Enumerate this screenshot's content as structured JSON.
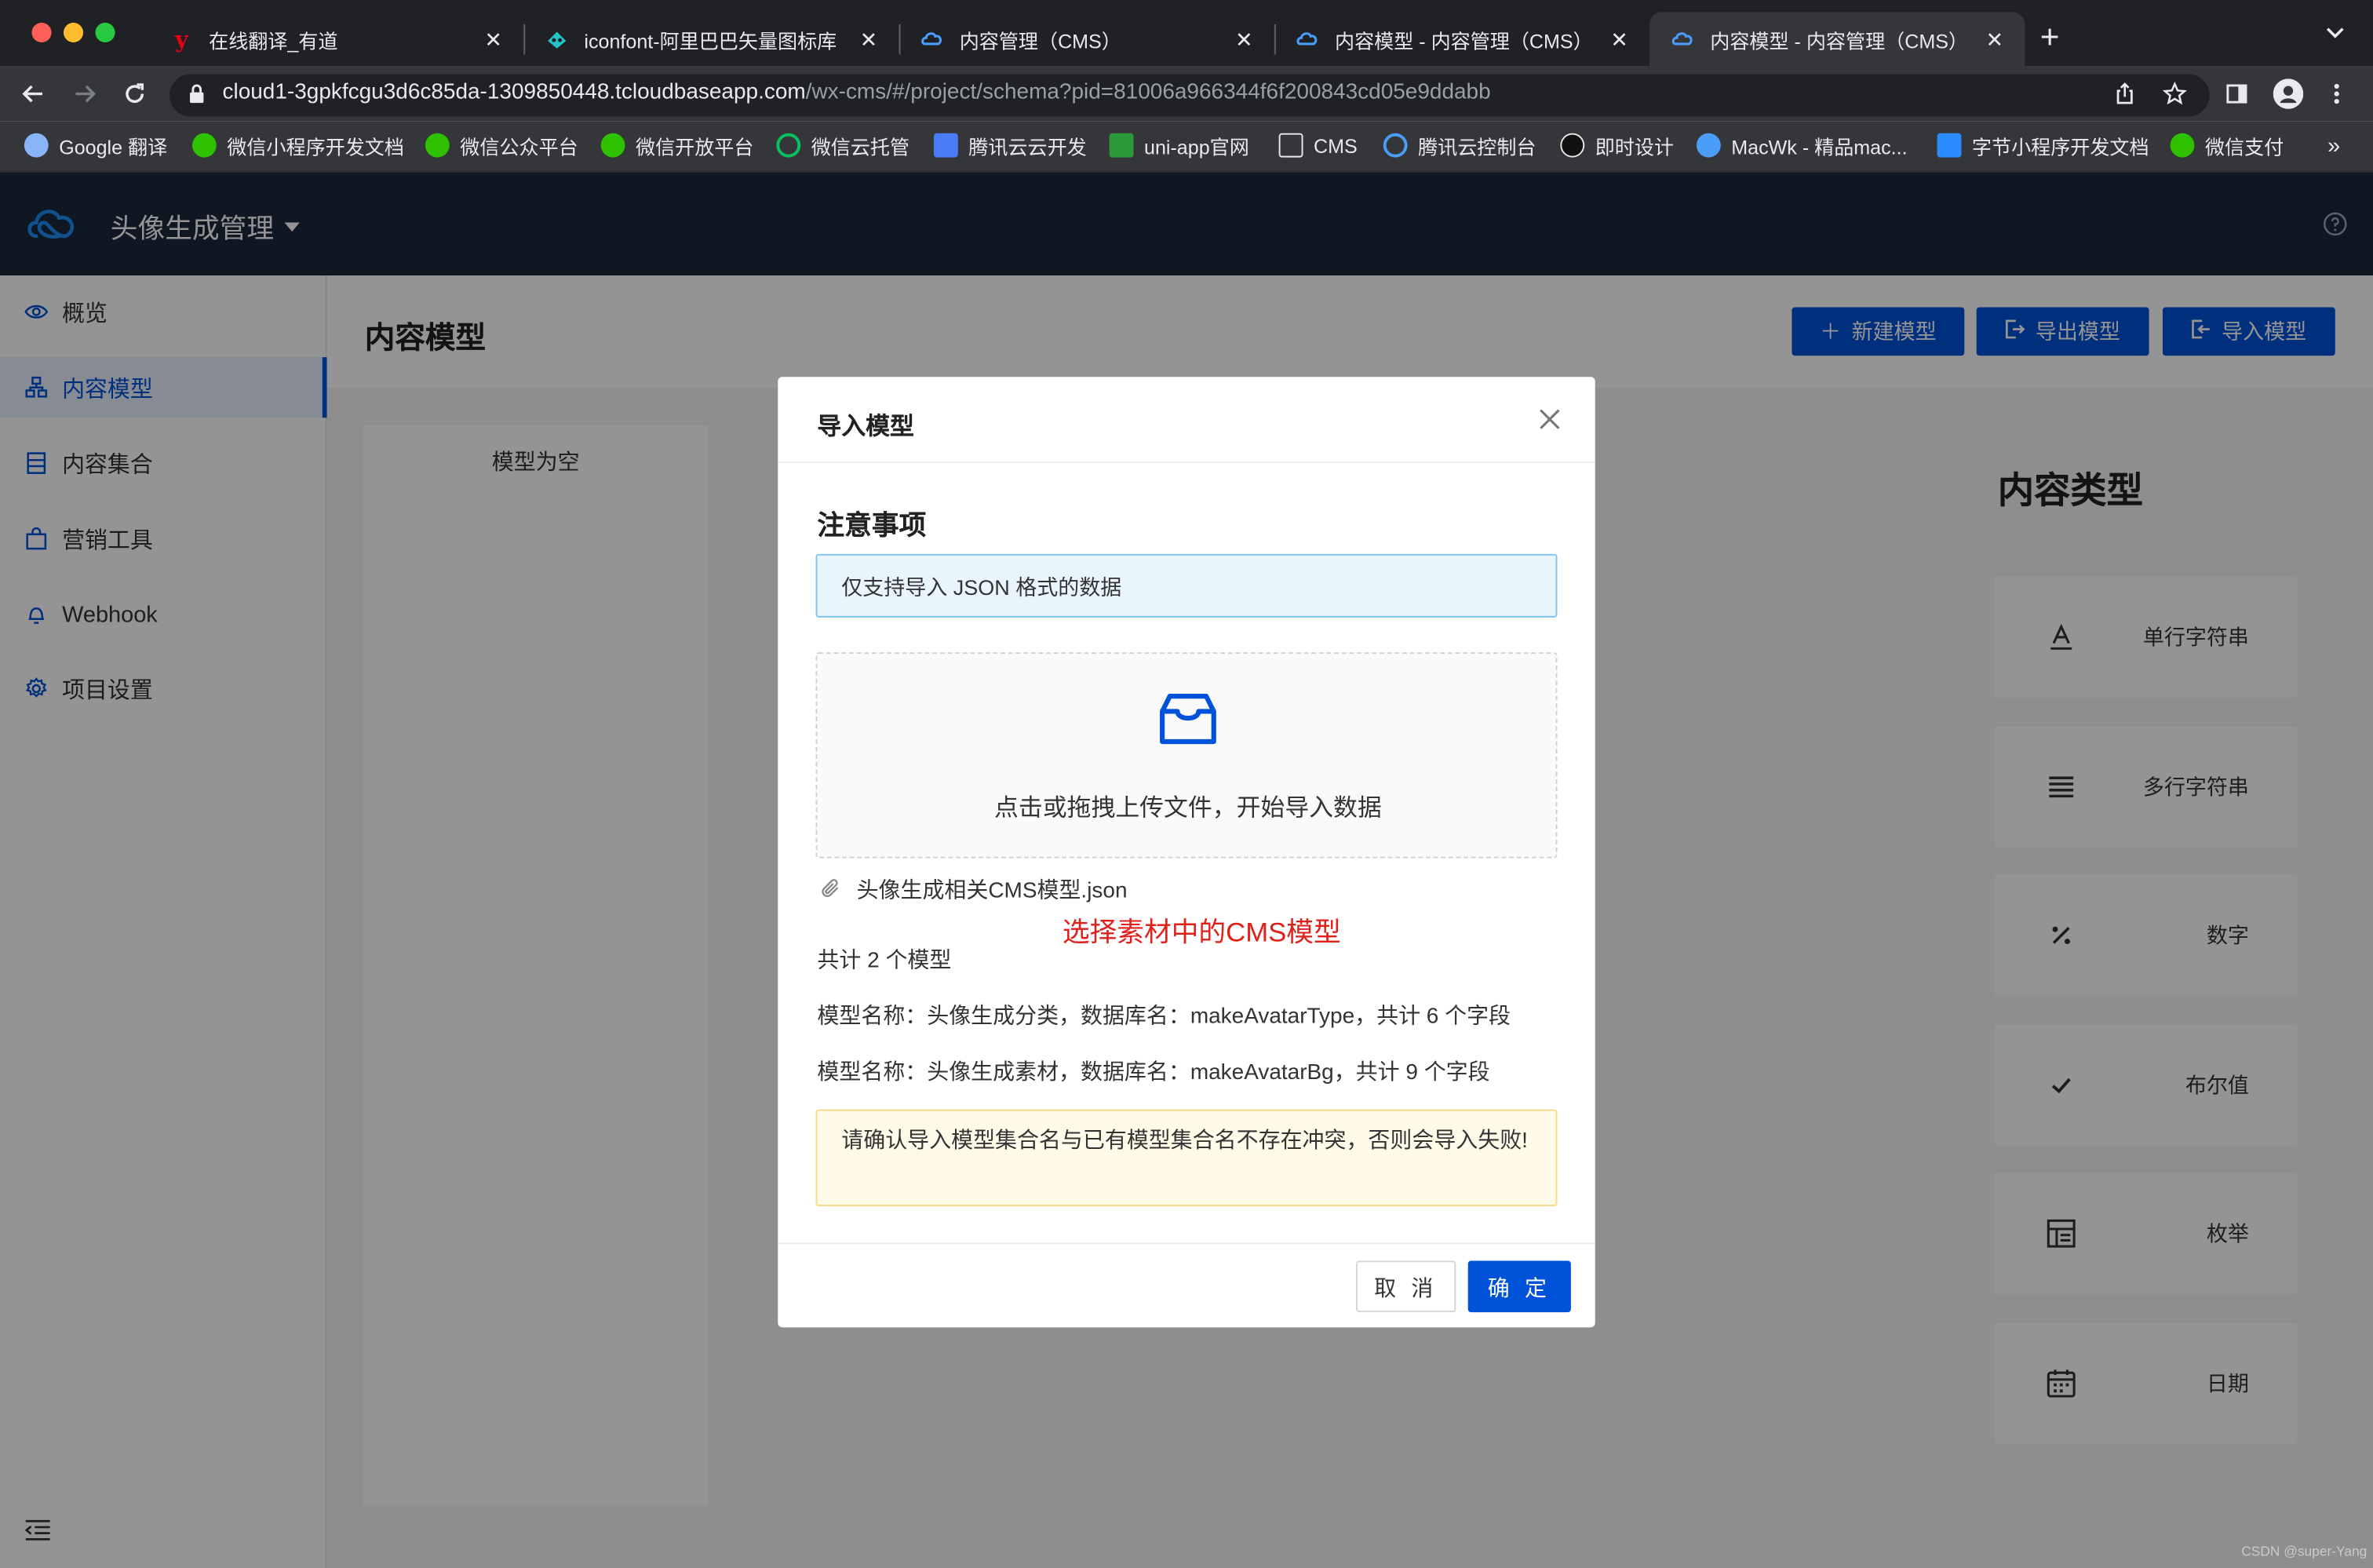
{
  "browser": {
    "tabs": [
      {
        "title": "在线翻译_有道",
        "icon": "youdao-icon"
      },
      {
        "title": "iconfont-阿里巴巴矢量图标库",
        "icon": "iconfont-icon"
      },
      {
        "title": "内容管理（CMS）",
        "icon": "cloudbase-icon"
      },
      {
        "title": "内容模型 - 内容管理（CMS）",
        "icon": "cloudbase-icon"
      },
      {
        "title": "内容模型 - 内容管理（CMS）",
        "icon": "cloudbase-icon",
        "active": true
      }
    ],
    "url_host": "cloud1-3gpkfcgu3d6c85da-1309850448.tcloudbaseapp.com",
    "url_path": "/wx-cms/#/project/schema?pid=81006a966344f6f200843cd05e9ddabb",
    "bookmarks": [
      {
        "label": "Google 翻译",
        "icon": "google-translate-icon"
      },
      {
        "label": "微信小程序开发文档",
        "icon": "wechat-icon"
      },
      {
        "label": "微信公众平台",
        "icon": "wechat-icon"
      },
      {
        "label": "微信开放平台",
        "icon": "wechat-icon"
      },
      {
        "label": "微信云托管",
        "icon": "wechat-cloud-icon"
      },
      {
        "label": "腾讯云云开发",
        "icon": "tencent-cloud-dev-icon"
      },
      {
        "label": "uni-app官网",
        "icon": "uniapp-icon"
      },
      {
        "label": "CMS",
        "icon": "folder-icon"
      },
      {
        "label": "腾讯云控制台",
        "icon": "tencent-cloud-icon"
      },
      {
        "label": "即时设计",
        "icon": "jishi-icon"
      },
      {
        "label": "MacWk - 精品mac...",
        "icon": "macwk-icon"
      },
      {
        "label": "字节小程序开发文档",
        "icon": "bytedance-icon"
      },
      {
        "label": "微信支付",
        "icon": "wechat-pay-icon"
      }
    ],
    "more": "»"
  },
  "app": {
    "project_name": "头像生成管理",
    "sidebar": [
      {
        "label": "概览",
        "icon": "eye-icon"
      },
      {
        "label": "内容模型",
        "icon": "model-icon",
        "active": true
      },
      {
        "label": "内容集合",
        "icon": "collection-icon"
      },
      {
        "label": "营销工具",
        "icon": "bag-icon"
      },
      {
        "label": "Webhook",
        "icon": "webhook-icon"
      },
      {
        "label": "项目设置",
        "icon": "gear-icon"
      }
    ],
    "page_title": "内容模型",
    "actions": {
      "new": "新建模型",
      "export": "导出模型",
      "import": "导入模型"
    },
    "empty_text": "模型为空",
    "types_title": "内容类型",
    "types": [
      {
        "label": "单行字符串",
        "icon": "text-a-icon"
      },
      {
        "label": "多行字符串",
        "icon": "lines-icon"
      },
      {
        "label": "数字",
        "icon": "percent-icon"
      },
      {
        "label": "布尔值",
        "icon": "check-icon"
      },
      {
        "label": "枚举",
        "icon": "enum-icon"
      },
      {
        "label": "日期",
        "icon": "calendar-icon"
      }
    ]
  },
  "dialog": {
    "title": "导入模型",
    "notice_title": "注意事项",
    "info": "仅支持导入 JSON 格式的数据",
    "upload_text": "点击或拖拽上传文件，开始导入数据",
    "file_name": "头像生成相关CMS模型.json",
    "annotation": "选择素材中的CMS模型",
    "total": "共计 2 个模型",
    "models": [
      "模型名称：头像生成分类，数据库名：makeAvatarType，共计 6 个字段",
      "模型名称：头像生成素材，数据库名：makeAvatarBg，共计 9 个字段"
    ],
    "warning": "请确认导入模型集合名与已有模型集合名不存在冲突，否则会导入失败!",
    "cancel": "取 消",
    "confirm": "确 定"
  },
  "watermark": "CSDN @super-Yang"
}
